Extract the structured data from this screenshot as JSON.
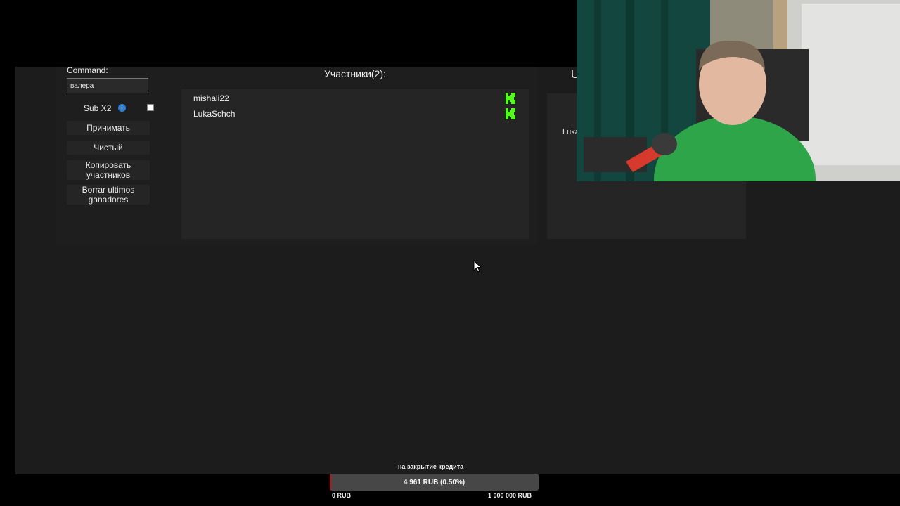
{
  "command": {
    "label": "Command:",
    "value": "валера"
  },
  "sub_option": {
    "label": "Sub X2",
    "info_icon": "info-icon",
    "checked": false
  },
  "buttons": {
    "accept": "Принимать",
    "clear": "Чистый",
    "copy_participants": "Копировать участников",
    "clear_last_winners": "Borrar ultimos ganadores"
  },
  "participants": {
    "title": "Участники(2):",
    "items": [
      {
        "name": "mishali22",
        "platform_icon": "kick-icon"
      },
      {
        "name": "LukaSchch",
        "platform_icon": "kick-icon"
      }
    ]
  },
  "winners": {
    "title_partial": "U",
    "name_partial": "Luka"
  },
  "credit": {
    "label": "на закрытие кредита",
    "value_text": "4 961 RUB (0.50%)",
    "progress_fraction": 0.005,
    "min_label": "0 RUB",
    "max_label": "1 000 000 RUB"
  },
  "colors": {
    "kick_green": "#53fc18",
    "progress_red": "#cc1111",
    "info_blue": "#2d7fd6"
  }
}
